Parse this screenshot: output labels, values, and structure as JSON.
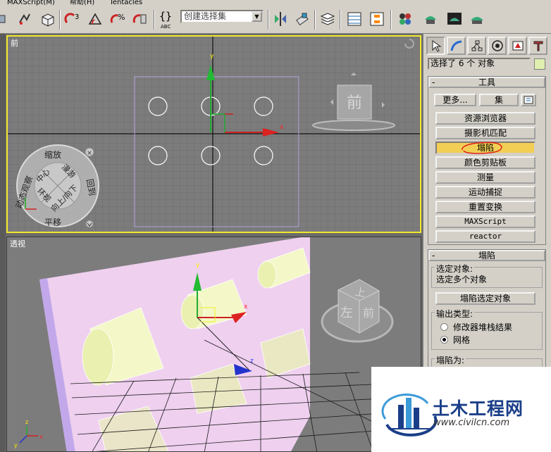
{
  "menu": {
    "items": [
      "MAXScript(M)",
      "帮助(H)",
      "Tentacles"
    ]
  },
  "toolbar": {
    "selection_set_value": "创建选择集"
  },
  "viewports": {
    "front": {
      "label": "前",
      "nav_ring": {
        "top": "缩放",
        "bottom": "平移",
        "left": "动态观察",
        "right": "回到",
        "center_tl": "中心",
        "center_tr": "漫游",
        "center_bl": "环视",
        "center_br": "向上/向下"
      },
      "viewcube_face": "前",
      "axis_x": "x",
      "axis_y": "y"
    },
    "perspective": {
      "label": "透视",
      "viewcube_top": "上",
      "viewcube_front": "前",
      "viewcube_left": "左",
      "axis_x": "x",
      "axis_y": "y",
      "axis_z": "z",
      "corner_axis_x": "x",
      "corner_axis_y": "y",
      "corner_axis_z": "z"
    }
  },
  "command_panel": {
    "selection_info": "选择了 6 个 对象",
    "swatch_color": "#dfefb0",
    "tools_rollout": {
      "title": "工具",
      "more_button": "更多...",
      "sets_button": "集",
      "buttons": [
        "资源浏览器",
        "摄影机匹配",
        "塌陷",
        "颜色剪贴板",
        "测量",
        "运动捕捉",
        "重置变换",
        "MAXScript",
        "reactor"
      ],
      "active_index": 2
    },
    "collapse_rollout": {
      "title": "塌陷",
      "selected_label": "选定对象:",
      "selected_value": "选定多个对象",
      "collapse_button": "塌陷选定对象",
      "output_type_title": "输出类型:",
      "option_modifier": "修改器堆栈结果",
      "option_mesh": "网格",
      "selected_option": "网格",
      "collapse_to_title": "塌陷为:"
    }
  },
  "watermark": {
    "title": "土木工程网",
    "url": "www.civilcn.com"
  },
  "colors": {
    "active_viewport_border": "#f2e82e",
    "active_button": "#f2cf54",
    "annotation_red": "#e0201a",
    "watermark_blue": "#1a3e88"
  }
}
